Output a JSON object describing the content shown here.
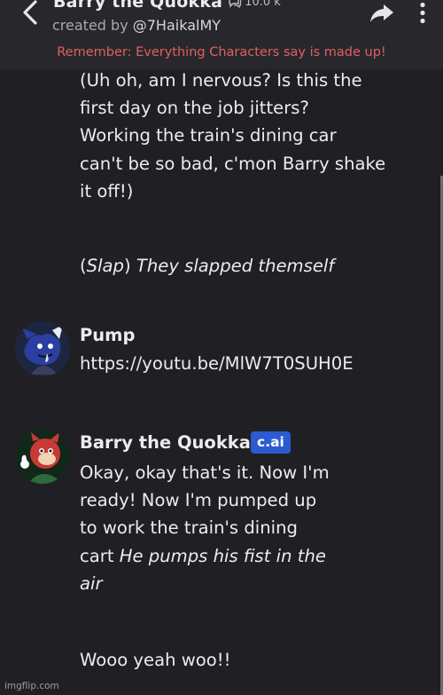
{
  "header": {
    "character_name": "Barry the Quokka",
    "chat_count": "10.0 k",
    "created_by_prefix": "created by",
    "creator_handle": "@7HaikalMY",
    "disclaimer": "Remember: Everything Characters say is made up!"
  },
  "messages": [
    {
      "sender": "",
      "lines": [
        "(Uh oh, am I nervous? Is this the",
        "first day on the job jitters?",
        "Working the train's dining car",
        "can't be so bad, c'mon Barry shake",
        "it off!)"
      ],
      "action": {
        "open_paren": "(",
        "slap": "Slap",
        "close_paren": ")",
        "text": "They slapped themself"
      }
    },
    {
      "sender": "Pump",
      "text": "https://youtu.be/MlW7T0SUH0E"
    },
    {
      "sender": "Barry the Quokka",
      "badge": "c.ai",
      "lines": [
        "Okay, okay that's it. Now I'm",
        "ready! Now I'm pumped up",
        "to work the train's dining"
      ],
      "line4_plain": "cart",
      "line4_italic": "He pumps his fist in the",
      "line5_italic": "air",
      "closing": "Wooo yeah woo!!"
    }
  ],
  "watermark": "imgflip.com",
  "colors": {
    "background": "#202024",
    "header": "#28282c",
    "disclaimer": "#e0605f",
    "badge": "#2c5ad1"
  }
}
